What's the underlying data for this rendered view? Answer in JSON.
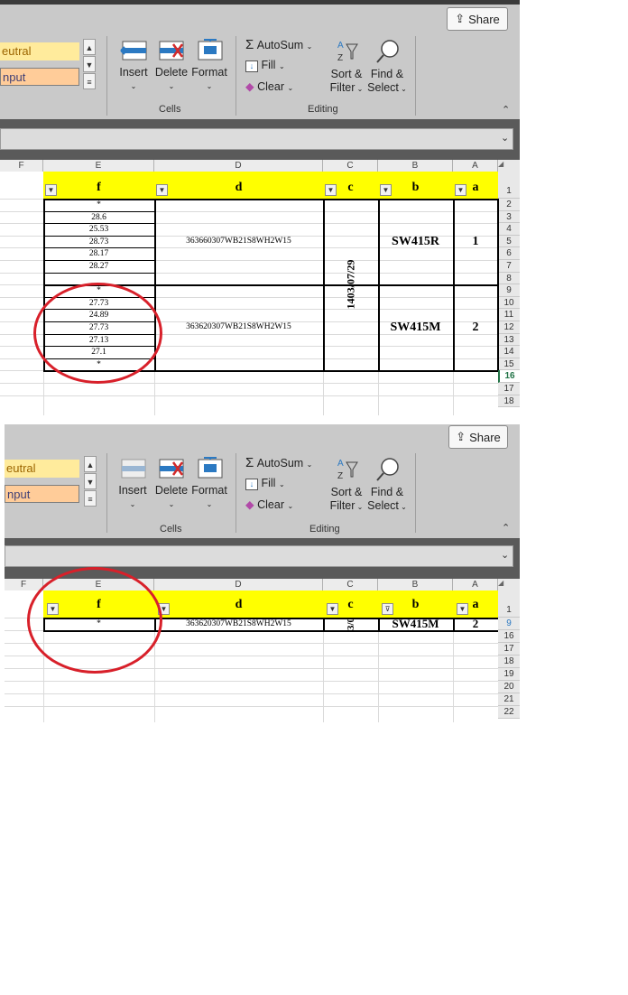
{
  "ribbon": {
    "share": "Share",
    "styles": {
      "neutral": "eutral",
      "input": "nput"
    },
    "cells_group": {
      "insert": "Insert",
      "delete": "Delete",
      "format": "Format",
      "label": "Cells"
    },
    "editing_group": {
      "autosum": "AutoSum",
      "fill": "Fill",
      "clear": "Clear",
      "sort_line1": "Sort &",
      "sort_line2": "Filter",
      "find_line1": "Find &",
      "find_line2": "Select",
      "label": "Editing"
    }
  },
  "columns": [
    "F",
    "E",
    "D",
    "C",
    "B",
    "A"
  ],
  "headers": {
    "f": "f",
    "d": "d",
    "c": "c",
    "b": "b",
    "a": "a"
  },
  "top": {
    "row_numbers": [
      "1",
      "2",
      "3",
      "4",
      "5",
      "6",
      "7",
      "8",
      "9",
      "10",
      "11",
      "12",
      "13",
      "14",
      "15",
      "16",
      "17",
      "18"
    ],
    "block1": {
      "f_values": [
        "*",
        "28.6",
        "25.53",
        "28.73",
        "28.17",
        "28.27"
      ],
      "d": "363660307WB21S8WH2W15",
      "b": "SW415R",
      "a": "1"
    },
    "block2": {
      "f_values": [
        "*",
        "27.73",
        "24.89",
        "27.73",
        "27.13",
        "27.1",
        "*"
      ],
      "d": "363620307WB21S8WH2W15",
      "b": "SW415M",
      "a": "2"
    },
    "c": "1403/07/29"
  },
  "bottom": {
    "row_numbers": [
      "1",
      "9",
      "16",
      "17",
      "18",
      "19",
      "20",
      "21",
      "22"
    ],
    "row9": {
      "f": "*",
      "d": "363620307WB21S8WH2W15",
      "c": "3/0",
      "b": "SW415M",
      "a": "2"
    }
  },
  "colors": {
    "header_fill": "#ffff00",
    "annotation": "#d8202a",
    "neutral": "#ffeb9c",
    "input": "#ffcc99"
  }
}
